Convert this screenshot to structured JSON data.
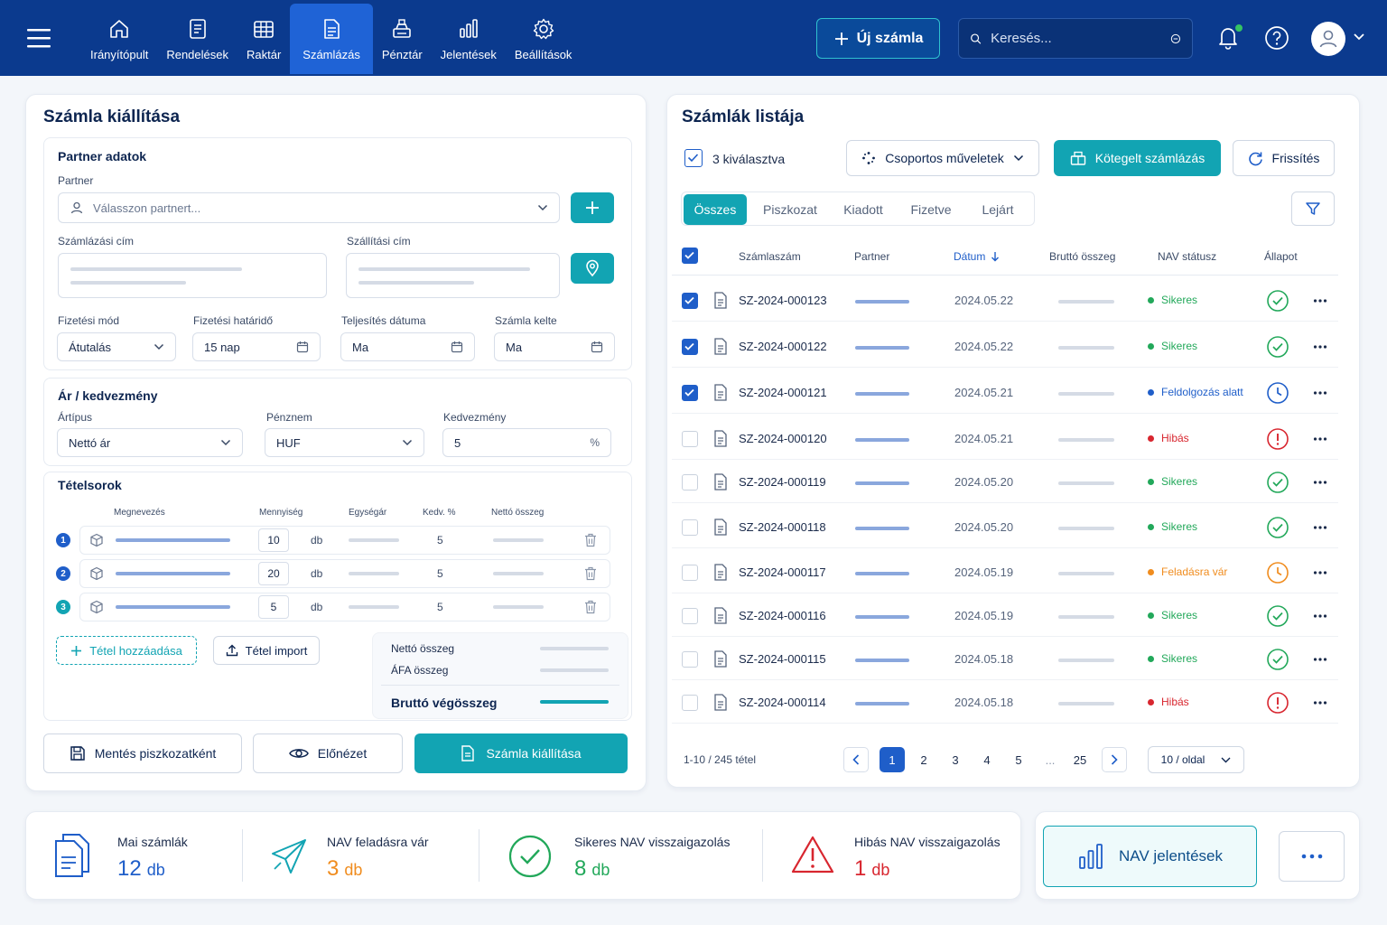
{
  "nav": {
    "items": [
      {
        "label": "Irányítópult",
        "icon": "home-icon"
      },
      {
        "label": "Rendelések",
        "icon": "orders-icon"
      },
      {
        "label": "Raktár",
        "icon": "warehouse-icon"
      },
      {
        "label": "Számlázás",
        "icon": "invoice-icon",
        "active": true
      },
      {
        "label": "Pénztár",
        "icon": "cash-register-icon"
      },
      {
        "label": "Jelentések",
        "icon": "reports-icon"
      },
      {
        "label": "Beállítások",
        "icon": "gear-icon"
      }
    ],
    "new_invoice_label": "Új számla",
    "search_placeholder": "Keresés..."
  },
  "invoice_form": {
    "title": "Számla kiállítása",
    "partner_section": {
      "title": "Partner adatok",
      "partner_label": "Partner",
      "partner_placeholder": "Válasszon partnert...",
      "billing_address_label": "Számlázási cím",
      "shipping_address_label": "Szállítási cím",
      "payment_method_label": "Fizetési mód",
      "payment_method_value": "Átutalás",
      "payment_deadline_label": "Fizetési határidő",
      "payment_deadline_value": "15 nap",
      "fulfillment_date_label": "Teljesítés dátuma",
      "fulfillment_date_value": "Ma",
      "invoice_date_label": "Számla kelte",
      "invoice_date_value": "Ma"
    },
    "price_section": {
      "title": "Ár / kedvezmény",
      "price_type_label": "Ártípus",
      "price_type_value": "Nettó ár",
      "currency_label": "Pénznem",
      "currency_value": "HUF",
      "discount_label": "Kedvezmény",
      "discount_value": "5",
      "discount_unit": "%"
    },
    "items_section": {
      "title": "Tételsorok",
      "columns": [
        "Megnevezés",
        "Mennyiség",
        "Egységár",
        "Kedv. %",
        "Nettó összeg"
      ],
      "rows": [
        {
          "num": "1",
          "qty": "10",
          "unit": "db",
          "discount": "5"
        },
        {
          "num": "2",
          "qty": "20",
          "unit": "db",
          "discount": "5"
        },
        {
          "num": "3",
          "qty": "5",
          "unit": "db",
          "discount": "5"
        }
      ],
      "add_item_label": "Tétel hozzáadása",
      "import_item_label": "Tétel import",
      "net_total_label": "Nettó összeg",
      "vat_total_label": "ÁFA összeg",
      "gross_total_label": "Bruttó végösszeg"
    },
    "save_draft_label": "Mentés piszkozatként",
    "preview_label": "Előnézet",
    "issue_label": "Számla kiállítása"
  },
  "invoice_list": {
    "title": "Számlák listája",
    "selected_label": "3 kiválasztva",
    "bulk_actions_label": "Csoportos műveletek",
    "batch_invoicing_label": "Kötegelt számlázás",
    "refresh_label": "Frissítés",
    "tabs": [
      "Összes",
      "Piszkozat",
      "Kiadott",
      "Fizetve",
      "Lejárt"
    ],
    "columns": {
      "number": "Számlaszám",
      "partner": "Partner",
      "date": "Dátum",
      "gross": "Bruttó összeg",
      "nav_status": "NAV státusz",
      "state": "Állapot"
    },
    "rows": [
      {
        "number": "SZ-2024-000123",
        "date": "2024.05.22",
        "nav_status": "Sikeres",
        "status": "success",
        "checked": true
      },
      {
        "number": "SZ-2024-000122",
        "date": "2024.05.22",
        "nav_status": "Sikeres",
        "status": "success",
        "checked": true
      },
      {
        "number": "SZ-2024-000121",
        "date": "2024.05.21",
        "nav_status": "Feldolgozás alatt",
        "status": "processing",
        "checked": true
      },
      {
        "number": "SZ-2024-000120",
        "date": "2024.05.21",
        "nav_status": "Hibás",
        "status": "error",
        "checked": false
      },
      {
        "number": "SZ-2024-000119",
        "date": "2024.05.20",
        "nav_status": "Sikeres",
        "status": "success",
        "checked": false
      },
      {
        "number": "SZ-2024-000118",
        "date": "2024.05.20",
        "nav_status": "Sikeres",
        "status": "success",
        "checked": false
      },
      {
        "number": "SZ-2024-000117",
        "date": "2024.05.19",
        "nav_status": "Feladásra vár",
        "status": "pending",
        "checked": false
      },
      {
        "number": "SZ-2024-000116",
        "date": "2024.05.19",
        "nav_status": "Sikeres",
        "status": "success",
        "checked": false
      },
      {
        "number": "SZ-2024-000115",
        "date": "2024.05.18",
        "nav_status": "Sikeres",
        "status": "success",
        "checked": false
      },
      {
        "number": "SZ-2024-000114",
        "date": "2024.05.18",
        "nav_status": "Hibás",
        "status": "error",
        "checked": false
      }
    ],
    "range_label": "1-10 / 245 tétel",
    "pages": [
      "1",
      "2",
      "3",
      "4",
      "5",
      "...",
      "25"
    ],
    "per_page_label": "10 / oldal"
  },
  "stats": {
    "today": {
      "label": "Mai számlák",
      "value": "12",
      "unit": "db"
    },
    "pending": {
      "label": "NAV feladásra vár",
      "value": "3",
      "unit": "db"
    },
    "success": {
      "label": "Sikeres NAV visszaigazolás",
      "value": "8",
      "unit": "db"
    },
    "error": {
      "label": "Hibás NAV visszaigazolás",
      "value": "1",
      "unit": "db"
    },
    "nav_reports_label": "NAV jelentések"
  },
  "colors": {
    "primary": "#0b3a8e",
    "accent": "#12a4b3",
    "success": "#22a85a",
    "processing": "#1f5ec9",
    "error": "#d8262f",
    "pending": "#f08c1e"
  }
}
